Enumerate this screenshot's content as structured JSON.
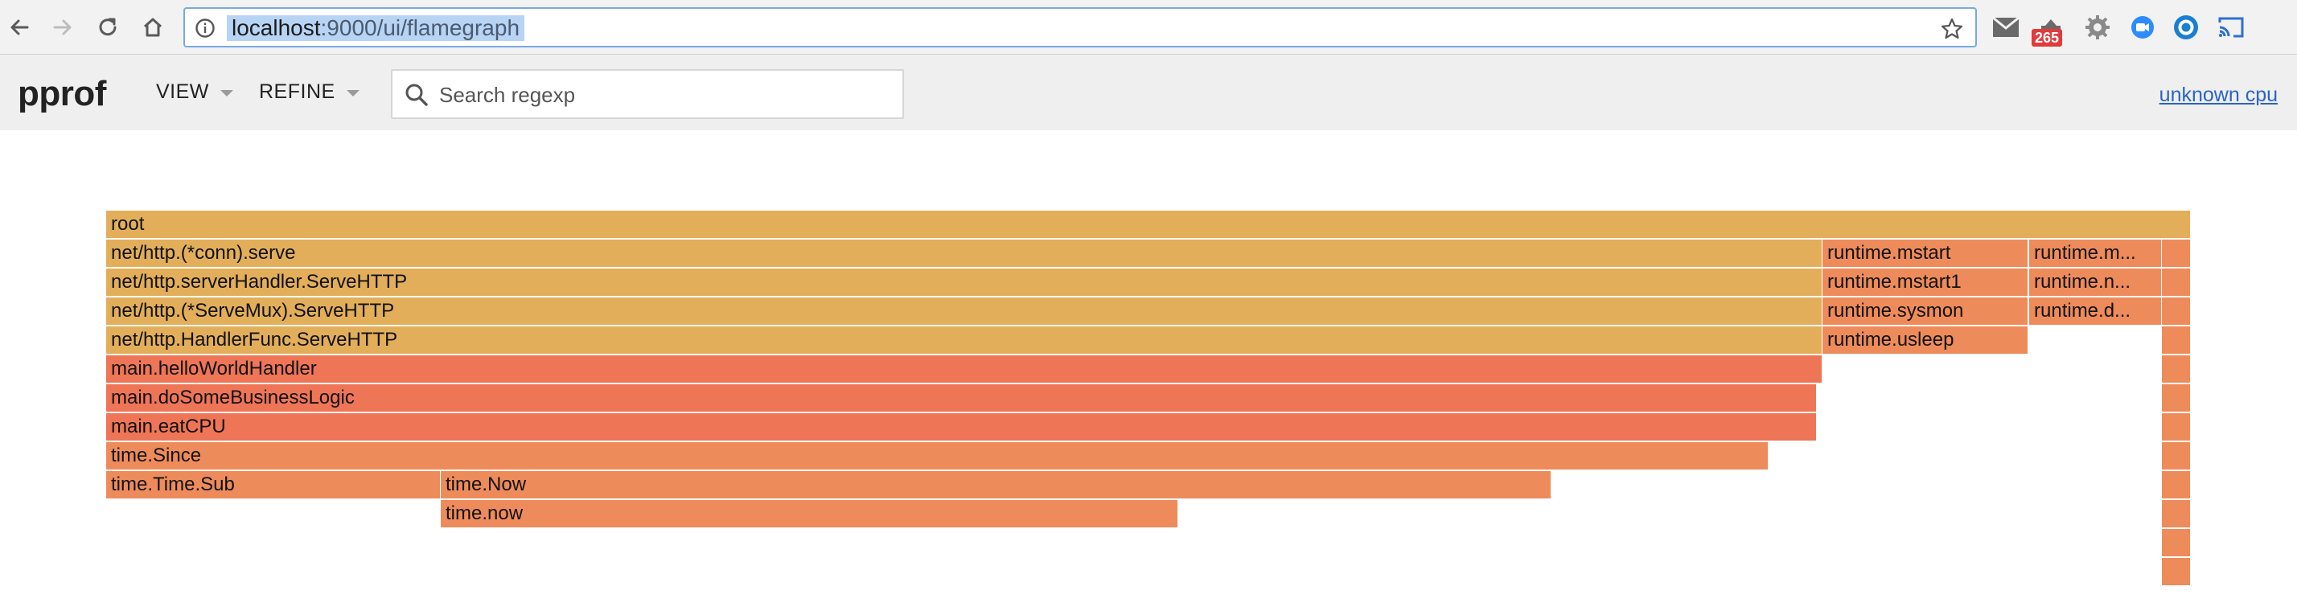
{
  "browser": {
    "url_host": "localhost",
    "url_path": ":9000/ui/flamegraph",
    "extension_badge": "265"
  },
  "app": {
    "title": "pprof",
    "menu_view": "VIEW",
    "menu_refine": "REFINE",
    "search_placeholder": "Search regexp",
    "profile_link": "unknown cpu"
  },
  "colors": {
    "frame_yellow": "#e2ae5a",
    "frame_orange": "#ee8b5a",
    "frame_red": "#ee7556",
    "accent_link": "#2a64c5"
  },
  "flamegraph": {
    "frames": [
      {
        "name": "root",
        "depth": 0,
        "start": 0.0,
        "width": 1.0,
        "color": "frame_yellow"
      },
      {
        "name": "net/http.(*conn).serve",
        "depth": 1,
        "start": 0.0,
        "width": 0.8234,
        "color": "frame_yellow"
      },
      {
        "name": "runtime.mstart",
        "depth": 1,
        "start": 0.8234,
        "width": 0.0989,
        "color": "frame_orange"
      },
      {
        "name": "runtime.m...",
        "depth": 1,
        "start": 0.9223,
        "width": 0.0638,
        "color": "frame_orange"
      },
      {
        "name": "",
        "depth": 1,
        "start": 0.9861,
        "width": 0.0139,
        "color": "frame_orange"
      },
      {
        "name": "net/http.serverHandler.ServeHTTP",
        "depth": 2,
        "start": 0.0,
        "width": 0.8234,
        "color": "frame_yellow"
      },
      {
        "name": "runtime.mstart1",
        "depth": 2,
        "start": 0.8234,
        "width": 0.0989,
        "color": "frame_orange"
      },
      {
        "name": "runtime.n...",
        "depth": 2,
        "start": 0.9223,
        "width": 0.0638,
        "color": "frame_orange"
      },
      {
        "name": "",
        "depth": 2,
        "start": 0.9861,
        "width": 0.0139,
        "color": "frame_orange"
      },
      {
        "name": "net/http.(*ServeMux).ServeHTTP",
        "depth": 3,
        "start": 0.0,
        "width": 0.8234,
        "color": "frame_yellow"
      },
      {
        "name": "runtime.sysmon",
        "depth": 3,
        "start": 0.8234,
        "width": 0.0989,
        "color": "frame_orange"
      },
      {
        "name": "runtime.d...",
        "depth": 3,
        "start": 0.9223,
        "width": 0.0638,
        "color": "frame_orange"
      },
      {
        "name": "",
        "depth": 3,
        "start": 0.9861,
        "width": 0.0139,
        "color": "frame_orange"
      },
      {
        "name": "net/http.HandlerFunc.ServeHTTP",
        "depth": 4,
        "start": 0.0,
        "width": 0.8234,
        "color": "frame_yellow"
      },
      {
        "name": "runtime.usleep",
        "depth": 4,
        "start": 0.8234,
        "width": 0.0989,
        "color": "frame_orange"
      },
      {
        "name": "",
        "depth": 4,
        "start": 0.9861,
        "width": 0.0139,
        "color": "frame_orange"
      },
      {
        "name": "main.helloWorldHandler",
        "depth": 5,
        "start": 0.0,
        "width": 0.8234,
        "color": "frame_red"
      },
      {
        "name": "",
        "depth": 5,
        "start": 0.9861,
        "width": 0.0139,
        "color": "frame_orange"
      },
      {
        "name": "main.doSomeBusinessLogic",
        "depth": 6,
        "start": 0.0,
        "width": 0.8206,
        "color": "frame_red"
      },
      {
        "name": "",
        "depth": 6,
        "start": 0.9861,
        "width": 0.0139,
        "color": "frame_orange"
      },
      {
        "name": "main.eatCPU",
        "depth": 7,
        "start": 0.0,
        "width": 0.8206,
        "color": "frame_red"
      },
      {
        "name": "",
        "depth": 7,
        "start": 0.9861,
        "width": 0.0139,
        "color": "frame_orange"
      },
      {
        "name": "time.Since",
        "depth": 8,
        "start": 0.0,
        "width": 0.7975,
        "color": "frame_orange"
      },
      {
        "name": "",
        "depth": 8,
        "start": 0.9861,
        "width": 0.0139,
        "color": "frame_orange"
      },
      {
        "name": "time.Time.Sub",
        "depth": 9,
        "start": 0.0,
        "width": 0.1604,
        "color": "frame_orange"
      },
      {
        "name": "time.Now",
        "depth": 9,
        "start": 0.1604,
        "width": 0.5327,
        "color": "frame_orange"
      },
      {
        "name": "",
        "depth": 9,
        "start": 0.9861,
        "width": 0.0139,
        "color": "frame_orange"
      },
      {
        "name": "time.now",
        "depth": 10,
        "start": 0.1604,
        "width": 0.3537,
        "color": "frame_orange"
      },
      {
        "name": "",
        "depth": 10,
        "start": 0.9861,
        "width": 0.0139,
        "color": "frame_orange"
      },
      {
        "name": "",
        "depth": 11,
        "start": 0.9861,
        "width": 0.0139,
        "color": "frame_orange"
      },
      {
        "name": "",
        "depth": 12,
        "start": 0.9861,
        "width": 0.0139,
        "color": "frame_orange"
      }
    ]
  }
}
